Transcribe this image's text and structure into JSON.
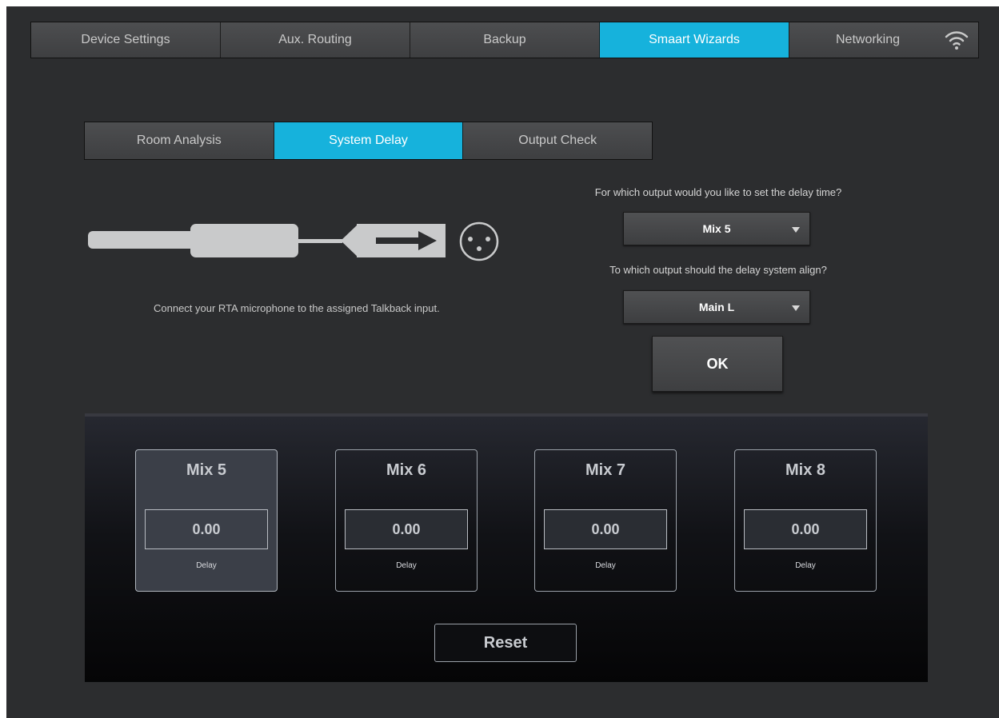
{
  "top_tabs": [
    {
      "label": "Device Settings",
      "active": false
    },
    {
      "label": "Aux. Routing",
      "active": false
    },
    {
      "label": "Backup",
      "active": false
    },
    {
      "label": "Smaart Wizards",
      "active": true
    },
    {
      "label": "Networking",
      "active": false
    }
  ],
  "sub_tabs": [
    {
      "label": "Room Analysis",
      "active": false
    },
    {
      "label": "System Delay",
      "active": true
    },
    {
      "label": "Output Check",
      "active": false
    }
  ],
  "instruction": "Connect your RTA microphone to the assigned Talkback input.",
  "output_question": "For which output would you like to set the delay time?",
  "output_select": "Mix 5",
  "align_question": "To which output should the delay system align?",
  "align_select": "Main L",
  "ok_label": "OK",
  "mixes": [
    {
      "name": "Mix 5",
      "value": "0.00",
      "label": "Delay",
      "selected": true
    },
    {
      "name": "Mix 6",
      "value": "0.00",
      "label": "Delay",
      "selected": false
    },
    {
      "name": "Mix 7",
      "value": "0.00",
      "label": "Delay",
      "selected": false
    },
    {
      "name": "Mix 8",
      "value": "0.00",
      "label": "Delay",
      "selected": false
    }
  ],
  "reset_label": "Reset",
  "icons": {
    "network_status": "wifi-icon",
    "cable": "xlr-cable-icon",
    "connector": "xlr-connector-icon",
    "dropdown": "caret-down-icon"
  },
  "colors": {
    "accent": "#16b2dc",
    "background": "#2c2d2f",
    "tab": "#444547"
  }
}
